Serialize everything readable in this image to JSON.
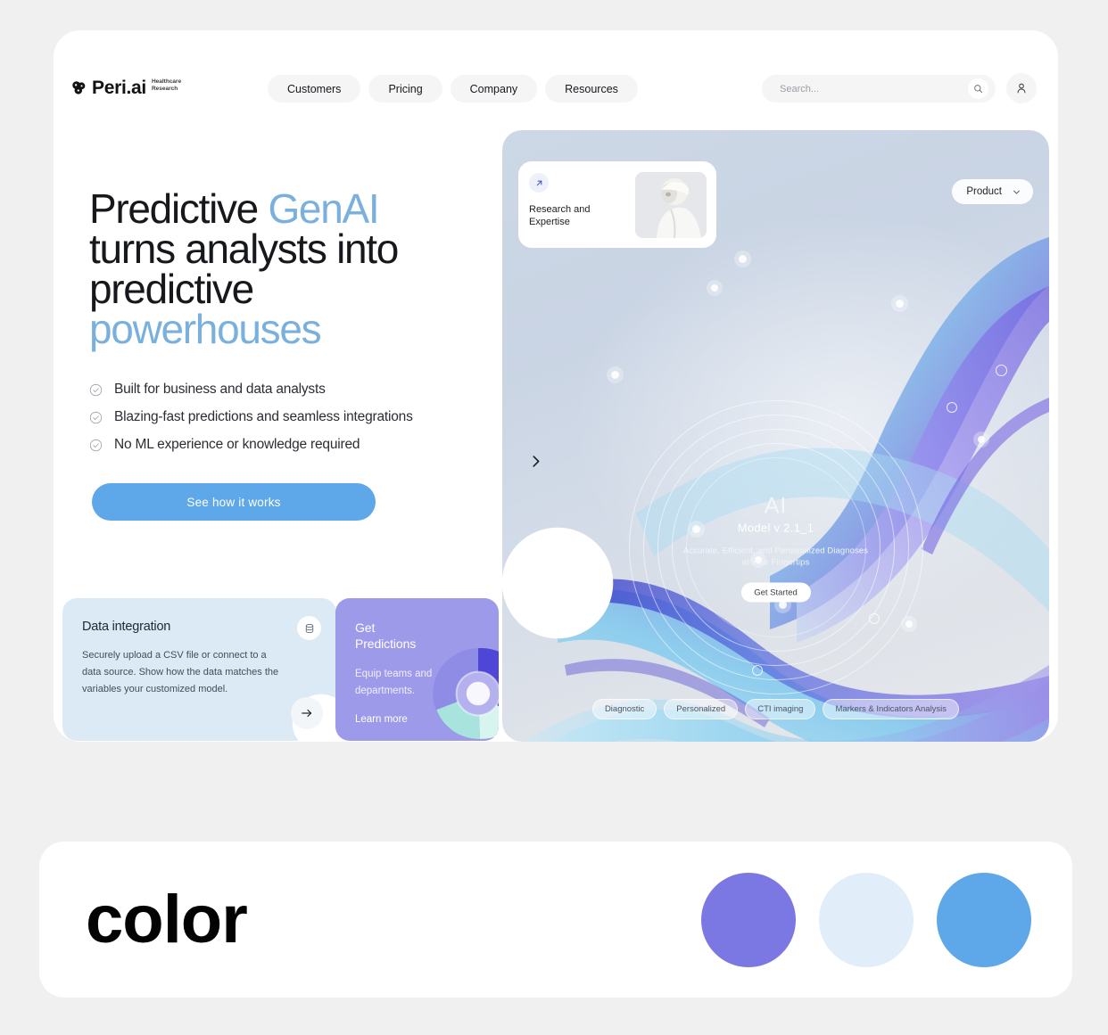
{
  "brand": {
    "name": "Peri.ai",
    "tagline": "Healthcare Research",
    "logo_icon": "peri-logo-icon"
  },
  "header": {
    "nav": [
      {
        "label": "Customers"
      },
      {
        "label": "Pricing"
      },
      {
        "label": "Company"
      },
      {
        "label": "Resources"
      }
    ],
    "search": {
      "placeholder": "Search...",
      "value": "",
      "icon": "search-icon"
    },
    "profile_icon": "user-icon"
  },
  "hero": {
    "headline": {
      "line1_plain": "Predictive ",
      "line1_accent": "GenAI",
      "line2": "turns analysts into",
      "line3": "predictive",
      "line4_accent": "powerhouses"
    },
    "bullets": [
      {
        "label": "Built for business and data analysts",
        "icon": "check-circle-icon"
      },
      {
        "label": "Blazing-fast predictions and seamless integrations",
        "icon": "check-circle-icon"
      },
      {
        "label": "No ML experience or knowledge required",
        "icon": "check-circle-icon"
      }
    ],
    "cta_label": "See how it works",
    "next_icon": "chevron-right-icon"
  },
  "visual": {
    "research_card": {
      "title": "Research and\nExpertise",
      "arrow_icon": "arrow-up-right-icon",
      "photo": "researcher-photo"
    },
    "product_dropdown": {
      "label": "Product",
      "icon": "chevron-down-icon"
    },
    "center": {
      "title": "AI",
      "model": "Model v 2.1_1",
      "description": "Accurate, Efficient, and Personalized Diagnoses at Your Fingertips",
      "cta_label": "Get Started"
    },
    "tags": [
      {
        "label": "Diagnostic"
      },
      {
        "label": "Personalized"
      },
      {
        "label": "CTI imaging"
      },
      {
        "label": "Markers & Indicators Analysis"
      }
    ]
  },
  "feature_cards": {
    "data_integration": {
      "title": "Data integration",
      "body": "Securely upload a CSV file or connect to a data source. Show how the data matches the variables your customized model.",
      "icon": "database-icon",
      "next_icon": "arrow-right-icon"
    },
    "predictions": {
      "title": "Get\nPredictions",
      "body": "Equip teams and departments.",
      "link_label": "Learn more",
      "chart_icon": "donut-chart-icon"
    }
  },
  "palette": {
    "heading": "color",
    "swatches": [
      {
        "name": "purple",
        "hex": "#7b78e3"
      },
      {
        "name": "pale-blue",
        "hex": "#e1edf8"
      },
      {
        "name": "blue",
        "hex": "#5ea7e8"
      }
    ]
  }
}
